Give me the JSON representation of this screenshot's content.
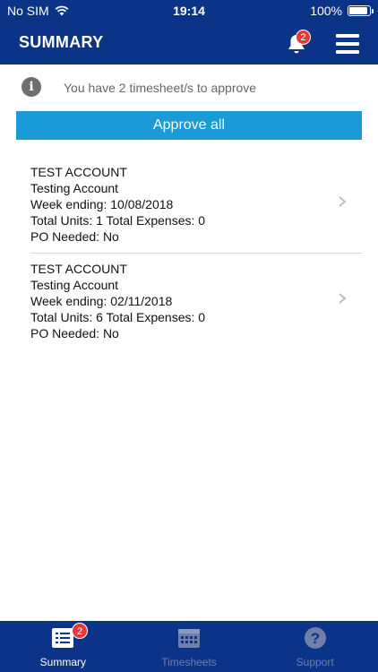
{
  "status_bar": {
    "carrier": "No SIM",
    "time": "19:14",
    "battery": "100%"
  },
  "header": {
    "title": "SUMMARY",
    "notification_count": "2",
    "icons": [
      "bell-icon",
      "hamburger-menu-icon"
    ]
  },
  "info": {
    "message": "You have 2 timesheet/s to approve",
    "icon": "info-icon"
  },
  "approve_all_label": "Approve all",
  "timesheets": [
    {
      "account": "TEST ACCOUNT",
      "description": "Testing Account",
      "week_ending": "Week ending: 10/08/2018",
      "totals": "Total Units: 1 Total Expenses: 0",
      "po_needed": "PO Needed: No"
    },
    {
      "account": "TEST ACCOUNT",
      "description": "Testing Account",
      "week_ending": "Week ending: 02/11/2018",
      "totals": "Total Units: 6 Total Expenses: 0",
      "po_needed": "PO Needed: No"
    }
  ],
  "tabbar": {
    "tabs": [
      {
        "label": "Summary",
        "icon": "summary-list-icon",
        "active": true,
        "badge": "2"
      },
      {
        "label": "Timesheets",
        "icon": "calendar-icon",
        "active": false
      },
      {
        "label": "Support",
        "icon": "help-icon",
        "active": false
      }
    ]
  },
  "colors": {
    "header": "#0b3488",
    "accent": "#1a9ad6",
    "badge": "#e53935"
  }
}
